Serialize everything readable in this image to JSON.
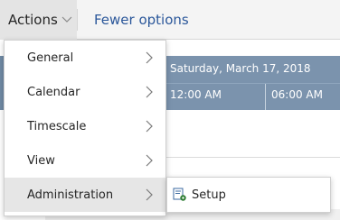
{
  "toolbar": {
    "actions_label": "Actions",
    "fewer_options_label": "Fewer options"
  },
  "calendar": {
    "date_label": "Saturday, March 17, 2018",
    "time_slots": [
      "12:00 AM",
      "06:00 AM"
    ],
    "header_color": "#7b93ad"
  },
  "menu": {
    "items": [
      {
        "label": "General",
        "icon": "chevron-right-icon"
      },
      {
        "label": "Calendar",
        "icon": "chevron-right-icon"
      },
      {
        "label": "Timescale",
        "icon": "chevron-right-icon"
      },
      {
        "label": "View",
        "icon": "chevron-right-icon"
      },
      {
        "label": "Administration",
        "icon": "chevron-right-icon",
        "active": true
      }
    ]
  },
  "submenu": {
    "items": [
      {
        "label": "Setup",
        "icon": "setup-icon"
      }
    ]
  },
  "colors": {
    "accent": "#2b579a",
    "menu_active_bg": "#e6e6e6"
  }
}
